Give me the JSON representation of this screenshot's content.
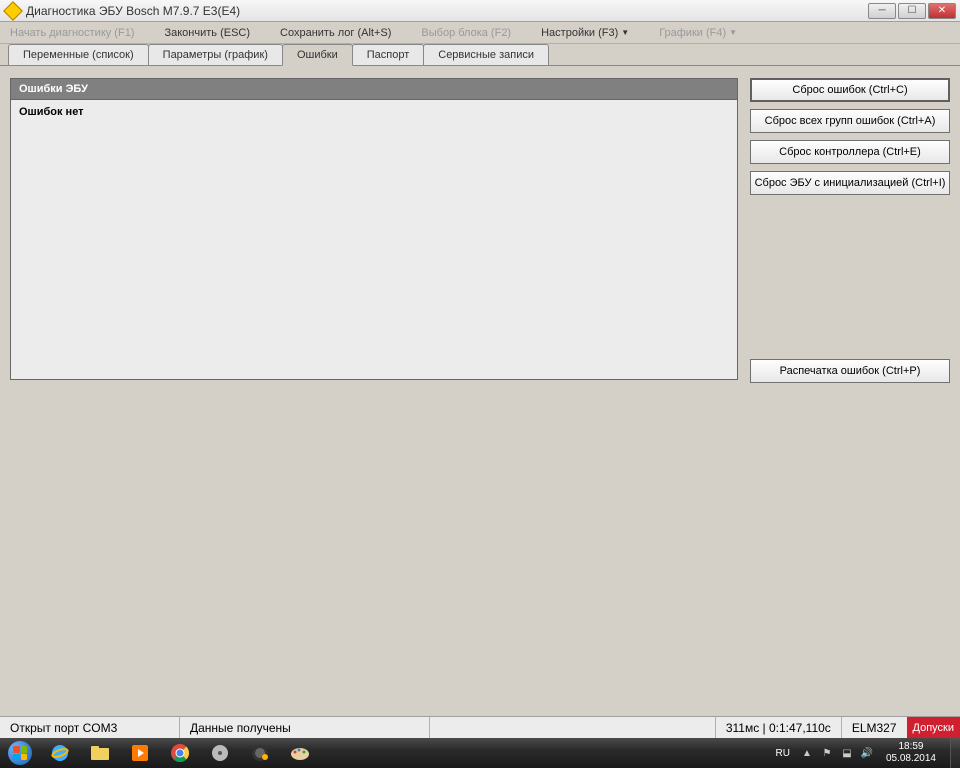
{
  "title": "Диагностика ЭБУ Bosch M7.9.7 E3(E4)",
  "menu": {
    "start_diag": "Начать диагностику (F1)",
    "finish": "Закончить (ESC)",
    "save_log": "Сохранить лог (Alt+S)",
    "select_block": "Выбор блока (F2)",
    "settings": "Настройки (F3)",
    "graphs": "Графики (F4)"
  },
  "tabs": {
    "vars_list": "Переменные (список)",
    "params_graph": "Параметры (график)",
    "errors": "Ошибки",
    "passport": "Паспорт",
    "service_records": "Сервисные записи"
  },
  "panel": {
    "header": "Ошибки ЭБУ",
    "body": "Ошибок нет"
  },
  "actions": {
    "reset_errors": "Сброс ошибок (Ctrl+C)",
    "reset_all_groups": "Сброс всех групп ошибок (Ctrl+A)",
    "reset_controller": "Сброс контроллера (Ctrl+E)",
    "reset_ecu_init": "Сброс ЭБУ с инициализацией (Ctrl+I)",
    "print_errors": "Распечатка ошибок (Ctrl+P)"
  },
  "status": {
    "port": "Открыт порт COM3",
    "data": "Данные получены",
    "timing": "311мс | 0:1:47,110с",
    "adapter": "ELM327",
    "tolerances": "Допуски"
  },
  "tray": {
    "lang": "RU",
    "time": "18:59",
    "date": "05.08.2014"
  }
}
